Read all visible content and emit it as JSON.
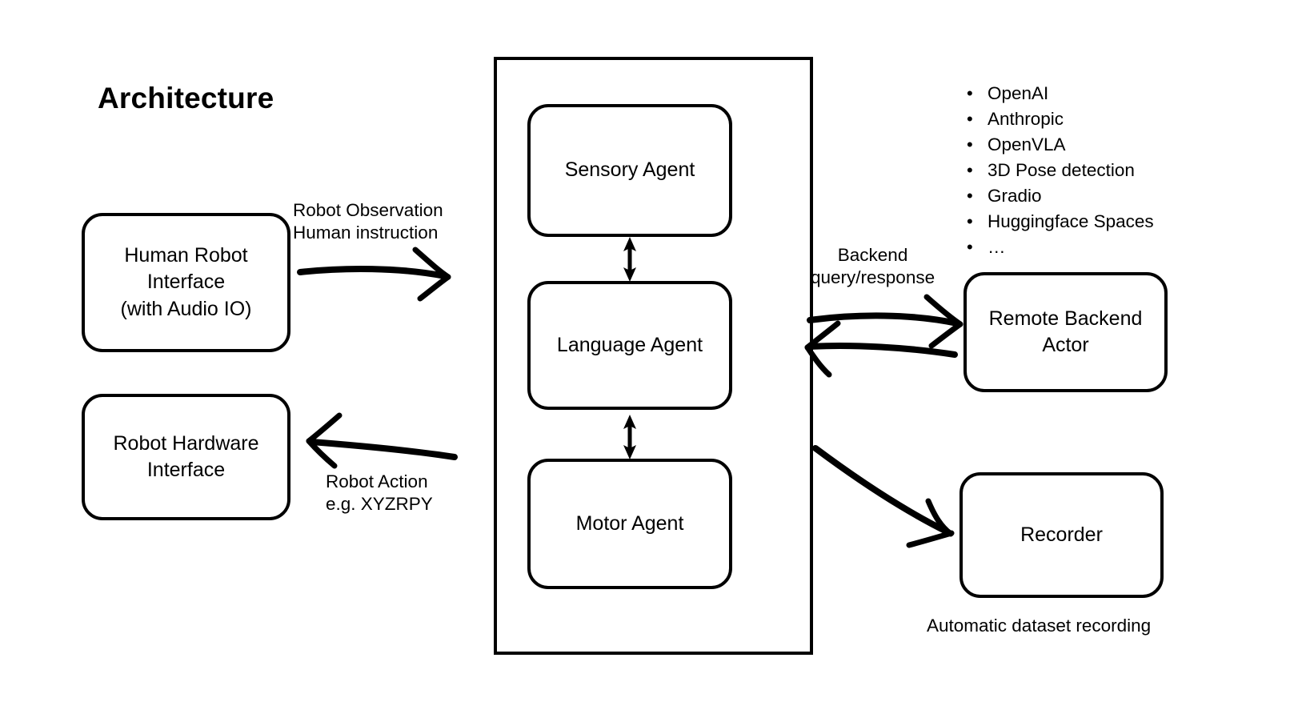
{
  "page": {
    "title": "Architecture",
    "background_color": "#ffffff",
    "stroke_color": "#000000"
  },
  "nodes": {
    "human_robot_interface": {
      "line1": "Human Robot",
      "line2": "Interface",
      "line3": "(with Audio IO)"
    },
    "robot_hardware_interface": {
      "line1": "Robot Hardware",
      "line2": "Interface"
    },
    "sensory_agent": {
      "label": "Sensory Agent"
    },
    "language_agent": {
      "label": "Language Agent"
    },
    "motor_agent": {
      "label": "Motor Agent"
    },
    "remote_backend_actor": {
      "line1": "Remote Backend",
      "line2": "Actor"
    },
    "recorder": {
      "label": "Recorder"
    }
  },
  "labels": {
    "robot_observation": {
      "line1": "Robot Observation",
      "line2": "Human instruction"
    },
    "robot_action": {
      "line1": "Robot Action",
      "line2": "e.g. XYZRPY"
    },
    "backend_query": {
      "line1": "Backend",
      "line2": "query/response"
    },
    "automatic_dataset_recording": "Automatic dataset recording"
  },
  "backend_options": {
    "bullet_glyph": "•",
    "items": [
      "OpenAI",
      "Anthropic",
      "OpenVLA",
      "3D Pose detection",
      "Gradio",
      "Huggingface Spaces",
      "…"
    ]
  }
}
